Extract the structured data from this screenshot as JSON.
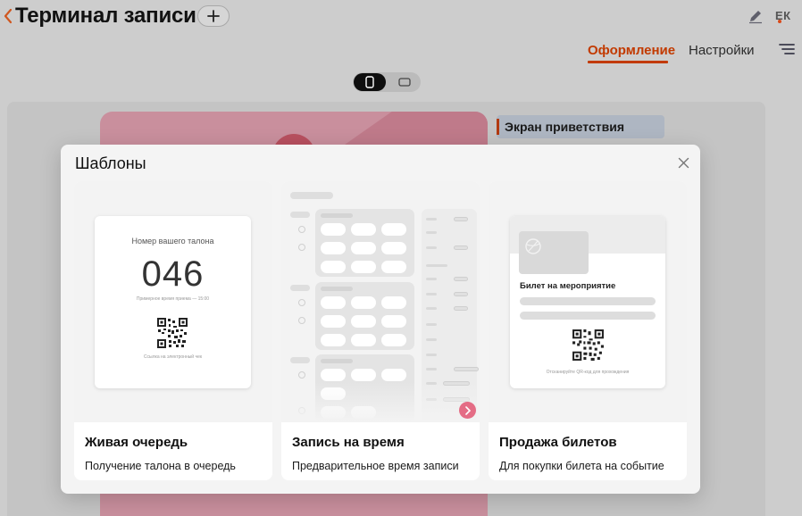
{
  "header": {
    "title": "Терминал записи",
    "avatar_initials": "ЕК",
    "accent_color": "#c23a00"
  },
  "tabs": [
    {
      "label": "Оформление",
      "active": true
    },
    {
      "label": "Настройки",
      "active": false
    }
  ],
  "device_toggle": {
    "selected": "phone",
    "options": [
      "phone",
      "tablet"
    ]
  },
  "sidebar": {
    "items": [
      {
        "label": "Экран приветствия",
        "active": true
      }
    ]
  },
  "modal": {
    "title": "Шаблоны",
    "templates": [
      {
        "title": "Живая очередь",
        "description": "Получение талона в очередь",
        "preview": {
          "label": "Номер вашего талона",
          "number": "046",
          "time_note": "Примерное время приема — 15:00",
          "link_note": "Ссылка на электронный чек"
        }
      },
      {
        "title": "Запись на время",
        "description": "Предварительное время записи"
      },
      {
        "title": "Продажа билетов",
        "description": "Для покупки билета на событие",
        "preview": {
          "ticket_title": "Билет на мероприятие",
          "caption": "Отсканируйте QR-код для прохождения"
        }
      }
    ]
  },
  "icons": [
    "chevron-left-icon",
    "plus-icon",
    "pencil-icon",
    "filter-menu-icon",
    "phone-icon",
    "tablet-icon",
    "close-icon",
    "qr-code-icon",
    "sun-icon",
    "moon-icon",
    "chevron-right-icon",
    "ball-icon"
  ]
}
